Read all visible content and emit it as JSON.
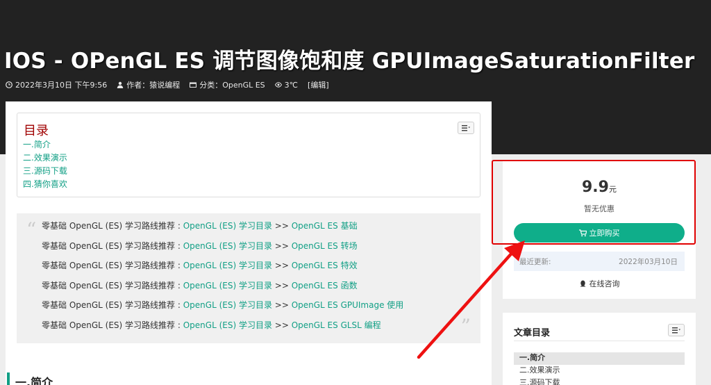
{
  "header": {
    "title": "IOS - OPenGL ES 调节图像饱和度 GPUImageSaturationFilter",
    "meta": {
      "date": "2022年3月10日 下午9:56",
      "author": "作者：猿说编程",
      "category": "分类：OpenGL ES",
      "temperature": "3℃",
      "edit": "[编辑]"
    }
  },
  "toc": {
    "title": "目录",
    "items": [
      "一.简介",
      "二.效果演示",
      "三.源码下载",
      "四.猜你喜欢"
    ]
  },
  "quote": {
    "open_mark": "“",
    "close_mark": "”",
    "lines": [
      {
        "prefix": "零基础 OpenGL (ES) 学习路线推荐 : ",
        "link1": "OpenGL (ES) 学习目录",
        "sep": " >> ",
        "link2": "OpenGL ES 基础"
      },
      {
        "prefix": "零基础 OpenGL (ES) 学习路线推荐 : ",
        "link1": "OpenGL (ES) 学习目录",
        "sep": " >> ",
        "link2": "OpenGL ES 转场"
      },
      {
        "prefix": "零基础 OpenGL (ES) 学习路线推荐 : ",
        "link1": "OpenGL (ES) 学习目录",
        "sep": " >> ",
        "link2": "OpenGL ES 特效"
      },
      {
        "prefix": "零基础 OpenGL (ES) 学习路线推荐 : ",
        "link1": "OpenGL (ES) 学习目录",
        "sep": " >> ",
        "link2": "OpenGL ES 函数"
      },
      {
        "prefix": "零基础 OpenGL (ES) 学习路线推荐 : ",
        "link1": "OpenGL (ES) 学习目录",
        "sep": " >> ",
        "link2": "OpenGL ES GPUImage 使用"
      },
      {
        "prefix": "零基础 OpenGL (ES) 学习路线推荐 : ",
        "link1": "OpenGL (ES) 学习目录",
        "sep": " >> ",
        "link2": "OpenGL ES GLSL 编程"
      }
    ]
  },
  "section": {
    "heading": "一.简介"
  },
  "purchase": {
    "price": "9.9",
    "currency": "元",
    "discount": "暂无优惠",
    "buy_label": "立即购买",
    "update_label": "最近更新:",
    "update_date": "2022年03月10日",
    "consult_label": "在线咨询"
  },
  "sidebar_toc": {
    "title": "文章目录",
    "items": [
      "一.简介",
      "二.效果演示",
      "三.源码下载"
    ]
  },
  "colors": {
    "accent": "#119f85",
    "button": "#0fae8a",
    "highlight": "#e00000",
    "hero_bg": "#222222"
  }
}
